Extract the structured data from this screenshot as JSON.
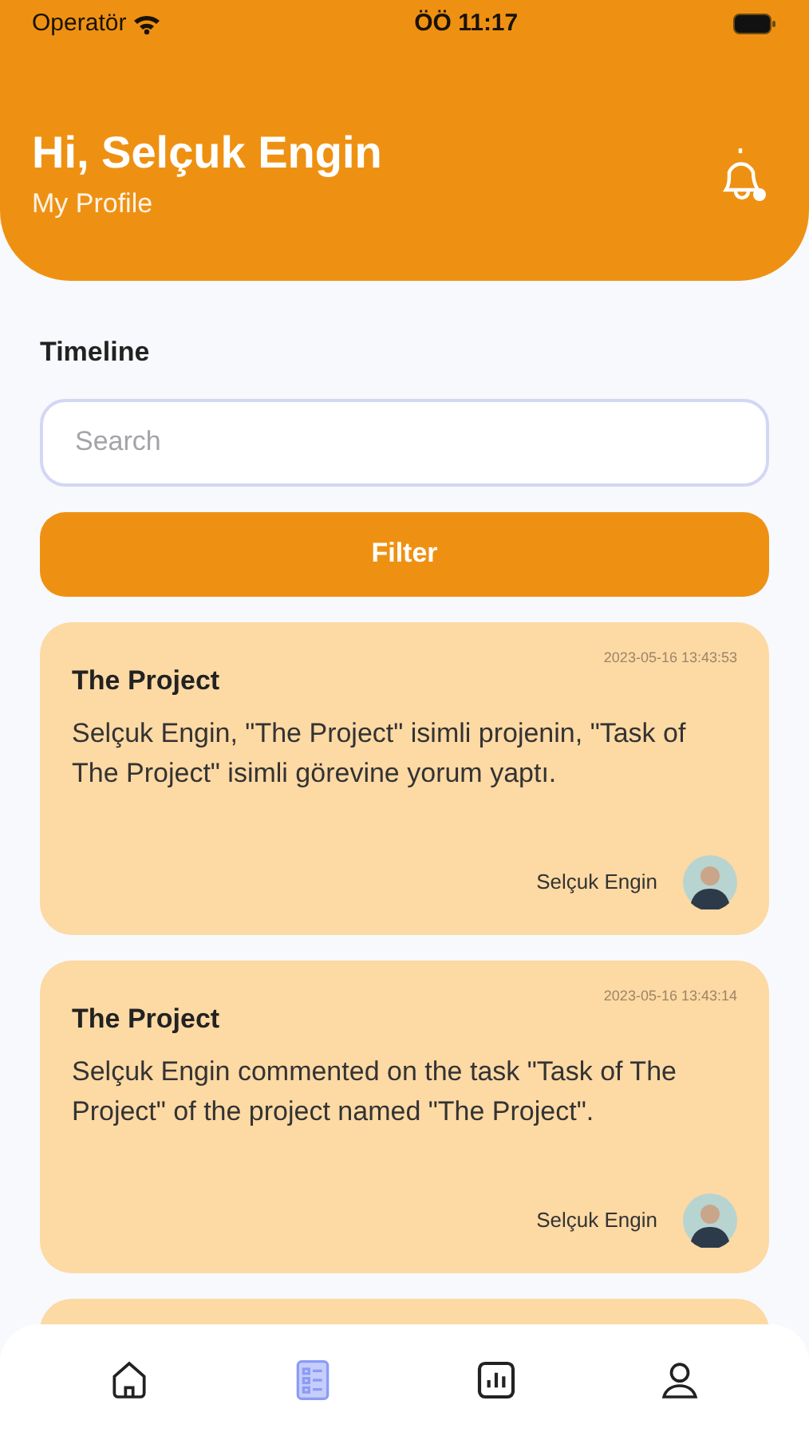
{
  "status_bar": {
    "carrier": "Operatör",
    "time": "ÖÖ 11:17"
  },
  "header": {
    "greeting": "Hi, Selçuk Engin",
    "subtitle": "My Profile",
    "has_notification": true
  },
  "section_title": "Timeline",
  "search": {
    "placeholder": "Search"
  },
  "filter_button": "Filter",
  "cards": [
    {
      "title": "The Project",
      "timestamp": "2023-05-16 13:43:53",
      "message": "Selçuk Engin, \"The Project\" isimli projenin, \"Task of The Project\" isimli görevine yorum yaptı.",
      "author": "Selçuk Engin"
    },
    {
      "title": "The Project",
      "timestamp": "2023-05-16 13:43:14",
      "message": "Selçuk Engin commented on the task \"Task of The Project\" of the project named \"The Project\".",
      "author": "Selçuk Engin"
    }
  ],
  "more_cards_below": true,
  "tabs": [
    {
      "kind": "home",
      "selected": false
    },
    {
      "kind": "list",
      "selected": true
    },
    {
      "kind": "chart",
      "selected": false
    },
    {
      "kind": "profile",
      "selected": false
    }
  ]
}
